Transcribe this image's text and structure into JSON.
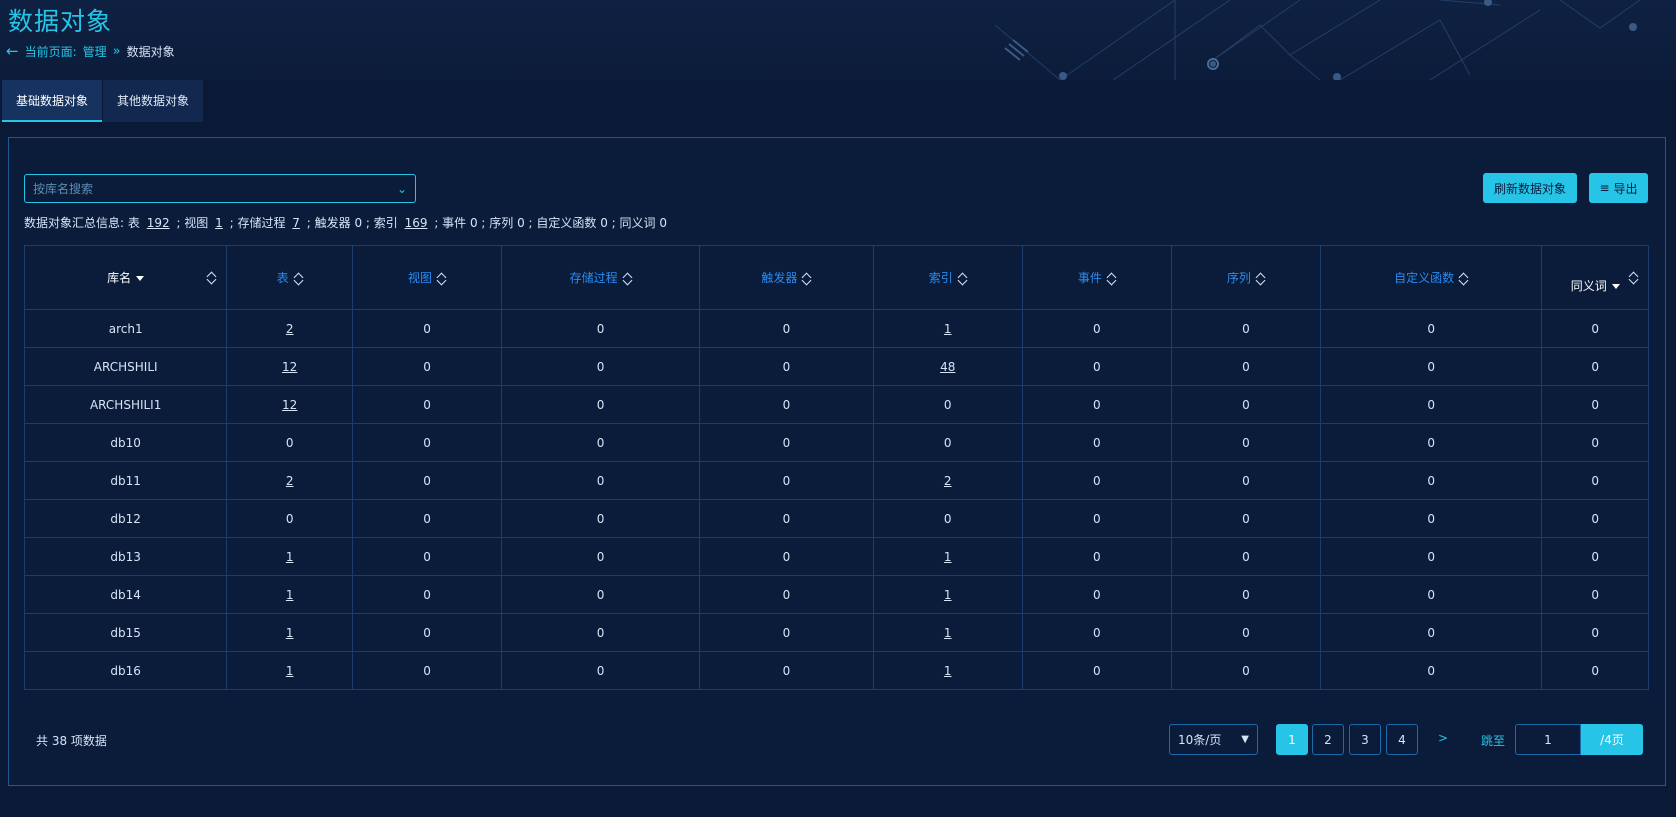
{
  "header": {
    "title": "数据对象",
    "breadcrumb_label": "当前页面:",
    "breadcrumb_parent": "管理",
    "breadcrumb_current": "数据对象"
  },
  "tabs": [
    {
      "label": "基础数据对象",
      "active": true
    },
    {
      "label": "其他数据对象",
      "active": false
    }
  ],
  "search": {
    "placeholder": "按库名搜索"
  },
  "buttons": {
    "refresh": "刷新数据对象",
    "export": "导出"
  },
  "summary": {
    "prefix": "数据对象汇总信息:",
    "table_label": "表",
    "table_count": "192",
    "view_label": "; 视图",
    "view_count": "1",
    "proc_label": "; 存储过程",
    "proc_count": "7",
    "rest": "; 触发器 0 ; 索引",
    "index_count": "169",
    "tail": "; 事件 0 ; 序列 0 ; 自定义函数 0 ; 同义词 0"
  },
  "table": {
    "columns": [
      "库名",
      "表",
      "视图",
      "存储过程",
      "触发器",
      "索引",
      "事件",
      "序列",
      "自定义函数",
      "同义词"
    ],
    "rows": [
      [
        "arch1",
        "2",
        "0",
        "0",
        "0",
        "1",
        "0",
        "0",
        "0",
        "0"
      ],
      [
        "ARCHSHILI",
        "12",
        "0",
        "0",
        "0",
        "48",
        "0",
        "0",
        "0",
        "0"
      ],
      [
        "ARCHSHILI1",
        "12",
        "0",
        "0",
        "0",
        "0",
        "0",
        "0",
        "0",
        "0"
      ],
      [
        "db10",
        "0",
        "0",
        "0",
        "0",
        "0",
        "0",
        "0",
        "0",
        "0"
      ],
      [
        "db11",
        "2",
        "0",
        "0",
        "0",
        "2",
        "0",
        "0",
        "0",
        "0"
      ],
      [
        "db12",
        "0",
        "0",
        "0",
        "0",
        "0",
        "0",
        "0",
        "0",
        "0"
      ],
      [
        "db13",
        "1",
        "0",
        "0",
        "0",
        "1",
        "0",
        "0",
        "0",
        "0"
      ],
      [
        "db14",
        "1",
        "0",
        "0",
        "0",
        "1",
        "0",
        "0",
        "0",
        "0"
      ],
      [
        "db15",
        "1",
        "0",
        "0",
        "0",
        "1",
        "0",
        "0",
        "0",
        "0"
      ],
      [
        "db16",
        "1",
        "0",
        "0",
        "0",
        "1",
        "0",
        "0",
        "0",
        "0"
      ]
    ]
  },
  "pagination": {
    "total_text": "共 38 项数据",
    "page_size": "10条/页",
    "pages": [
      "1",
      "2",
      "3",
      "4"
    ],
    "current_page": "1",
    "next": ">",
    "jump_label": "跳至",
    "jump_value": "1",
    "total_pages": "/4页"
  },
  "colors": {
    "accent": "#26c4e6",
    "header_link": "#2a8bf0",
    "background": "#0a1a36",
    "border": "#1b3d6b"
  }
}
